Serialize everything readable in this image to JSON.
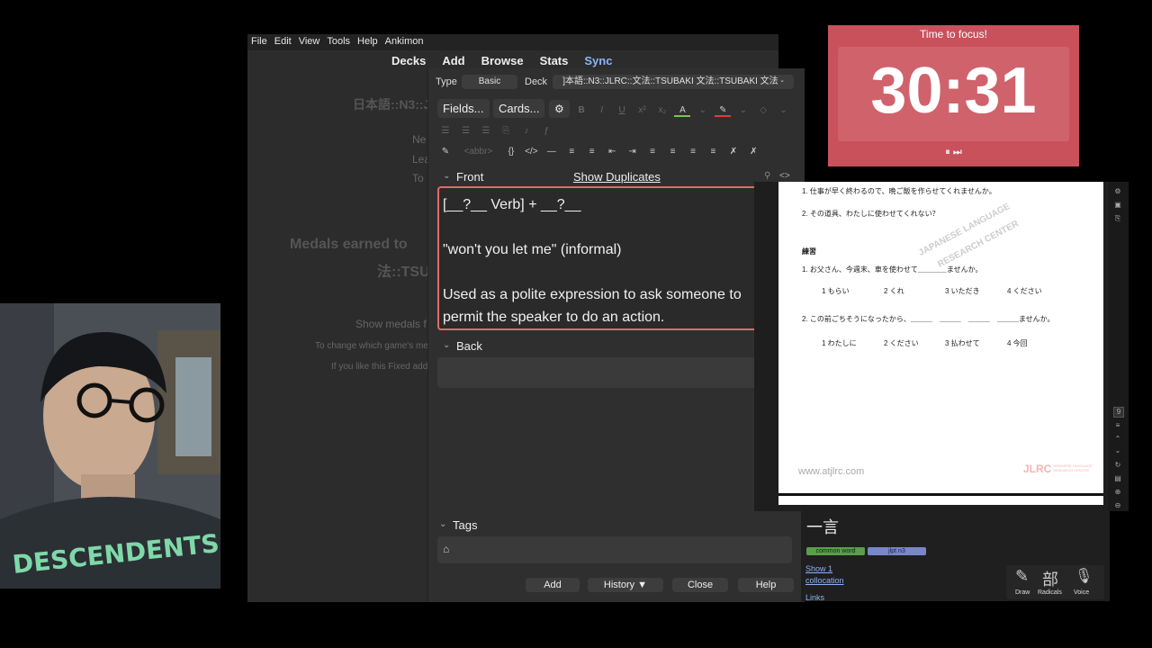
{
  "menu": [
    "File",
    "Edit",
    "View",
    "Tools",
    "Help",
    "Ankimon"
  ],
  "topnav": [
    "Decks",
    "Add",
    "Browse",
    "Stats",
    "Sync"
  ],
  "main_bg": {
    "deck_title": "日本語::N3::J",
    "lines": [
      "Ne",
      "Lea",
      "To"
    ],
    "medals_title_1": "Medals earned to",
    "medals_title_2": "法::TSU",
    "show_medals": "Show medals f",
    "change_game": "To change which game's me",
    "fixed_addon": "If you like this Fixed add"
  },
  "add_window": {
    "type_label": "Type",
    "type_value": "Basic",
    "deck_label": "Deck",
    "deck_value": "]本語::N3::JLRC::文法::TSUBAKI 文法::TSUBAKI 文法 -",
    "fields_button": "Fields...",
    "cards_button": "Cards...",
    "abbr": "<abbr>",
    "front_label": "Front",
    "show_duplicates": "Show Duplicates",
    "front_lines": [
      "[__?__ Verb] + __?__",
      "",
      "\"won't you let me\" (informal)",
      "",
      "Used as a polite expression to ask someone to",
      "permit the speaker to do an action."
    ],
    "back_label": "Back",
    "tags_label": "Tags",
    "buttons": [
      "Add",
      "History ▼",
      "Close",
      "Help"
    ]
  },
  "timer": {
    "title": "Time to focus!",
    "time": "30:31",
    "controls": "⏸ ⏭"
  },
  "pdf": {
    "line1": "1. 仕事が早く終わるので、晩ご飯を作らせてくれませんか。",
    "line2": "2. その道具、わたしに使わせてくれない？",
    "watermark_1": "JAPANESE LANGUAGE",
    "watermark_2": "RESEARCH CENTER",
    "section": "練習",
    "q1": "1. お父さん、今週末、車を使わせて＿＿＿＿ませんか。",
    "q1_options": [
      "1 もらい",
      "2 くれ",
      "3 いただき",
      "4 ください"
    ],
    "q2": "2. この前ごちそうになったから、＿＿＿　＿＿＿　＿＿＿　＿＿＿ませんか。",
    "q2_options": [
      "1 わたしに",
      "2 ください",
      "3 払わせて",
      "4 今回"
    ],
    "footer_url": "www.atjlrc.com",
    "footer_logo": "JLRC",
    "footer_logo_sub": "JAPANESE LANGUAGE RESEARCH CENTER",
    "page_indicator": "9"
  },
  "dict": {
    "word": "一言",
    "tag1": "common word",
    "tag2": "jlpt n3",
    "show": "Show 1",
    "collocation": "collocation",
    "links": "Links",
    "tools": [
      "Draw",
      "Radicals",
      "Voice"
    ],
    "tool_glyphs": [
      "✎",
      "部",
      "🎙"
    ]
  },
  "colors": {
    "timer_bg": "#c9515c",
    "editor_border": "#e36a6a",
    "sync_link": "#8ab4f8",
    "tag_green": "#5a9e4b",
    "tag_blue": "#7a86c8"
  }
}
